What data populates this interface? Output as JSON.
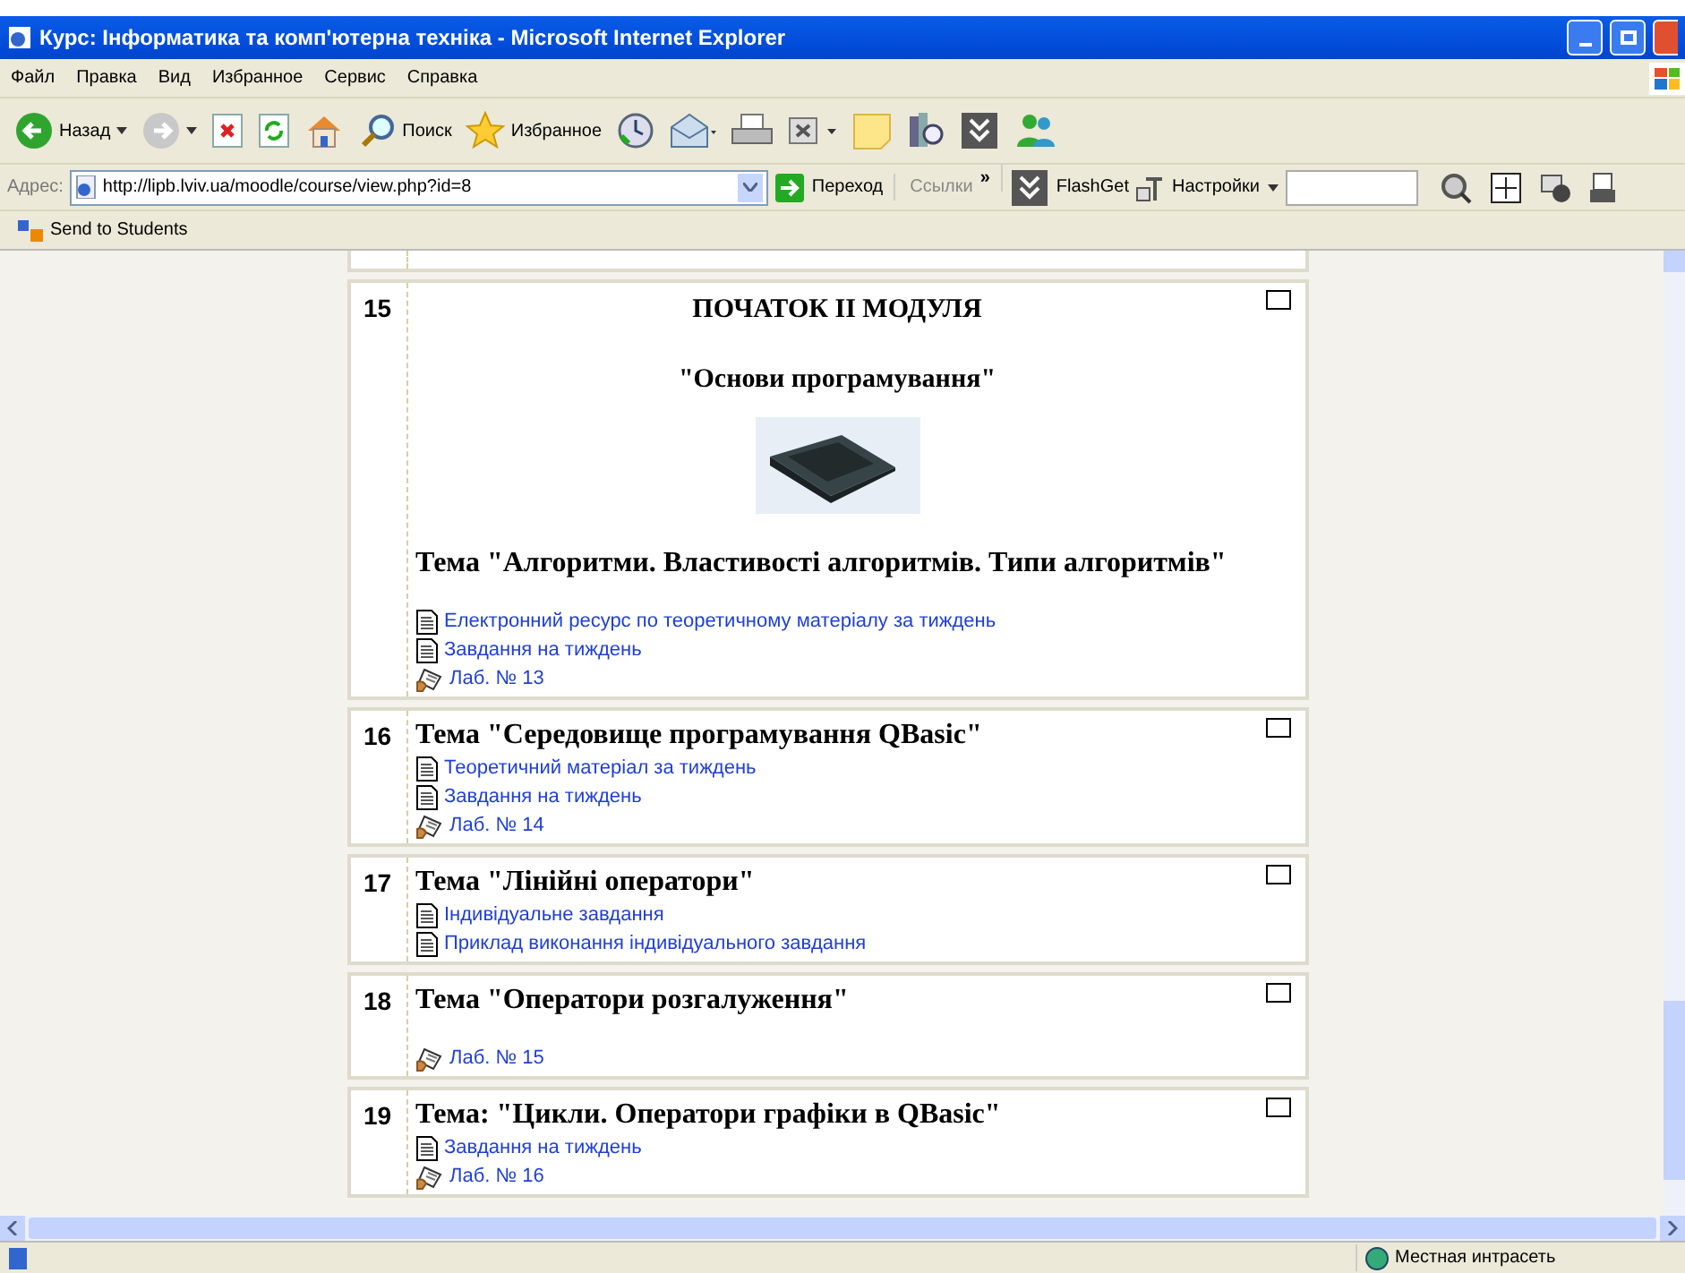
{
  "window": {
    "title": "Курс: Інформатика та комп'ютерна техніка - Microsoft Internet Explorer"
  },
  "menu": [
    "Файл",
    "Правка",
    "Вид",
    "Избранное",
    "Сервис",
    "Справка"
  ],
  "toolbar": [
    {
      "kind": "back",
      "label": "Назад"
    },
    {
      "kind": "forward"
    },
    {
      "kind": "stop"
    },
    {
      "kind": "refresh"
    },
    {
      "kind": "home"
    },
    {
      "kind": "search",
      "label": "Поиск"
    },
    {
      "kind": "favorites",
      "label": "Избранное"
    },
    {
      "kind": "history"
    },
    {
      "kind": "mail"
    },
    {
      "kind": "print"
    },
    {
      "kind": "edit"
    },
    {
      "kind": "note"
    },
    {
      "kind": "research"
    },
    {
      "kind": "flashget"
    },
    {
      "kind": "messenger"
    }
  ],
  "address": {
    "label": "Адрес:",
    "url": "http://lipb.lviv.ua/moodle/course/view.php?id=8",
    "go": "Переход",
    "links": "Ссылки",
    "more": "»",
    "flashget": "FlashGet",
    "settings": "Настройки"
  },
  "links_bar": {
    "item": "Send to Students"
  },
  "sections": [
    {
      "number": "15",
      "headings": [
        "ПОЧАТОК ІІ МОДУЛЯ",
        "\"Основи програмування\""
      ],
      "image": true,
      "topic": "Тема \"Алгоритми. Властивості алгоритмів. Типи алгоритмів\"",
      "spaced": true,
      "resources": [
        {
          "kind": "page",
          "label": "Електронний ресурс по теоретичному матеріалу за тиждень"
        },
        {
          "kind": "page",
          "label": "Завдання на тиждень"
        },
        {
          "kind": "lab",
          "label": "Лаб. № 13"
        }
      ]
    },
    {
      "number": "16",
      "topic": "Тема \"Середовище програмування QBasic\"",
      "spaced": false,
      "resources": [
        {
          "kind": "page",
          "label": "Теоретичний матеріал за тиждень"
        },
        {
          "kind": "page",
          "label": "Завдання на тиждень"
        },
        {
          "kind": "lab",
          "label": "Лаб. № 14"
        }
      ]
    },
    {
      "number": "17",
      "topic": "Тема \"Лінійні оператори\"",
      "spaced": false,
      "resources": [
        {
          "kind": "page",
          "label": "Індивідуальне завдання"
        },
        {
          "kind": "page",
          "label": "Приклад виконання індивідуального завдання"
        }
      ]
    },
    {
      "number": "18",
      "topic": "Тема \"Оператори розгалуження\"",
      "spaced": true,
      "resources": [
        {
          "kind": "lab",
          "label": "Лаб. № 15"
        }
      ]
    },
    {
      "number": "19",
      "topic": "Тема: \"Цикли. Оператори графіки в QBasic\"",
      "spaced": false,
      "resources": [
        {
          "kind": "page",
          "label": "Завдання на тиждень"
        },
        {
          "kind": "lab",
          "label": "Лаб. № 16"
        }
      ]
    }
  ],
  "status_bar": {
    "zone": "Местная интрасеть"
  }
}
